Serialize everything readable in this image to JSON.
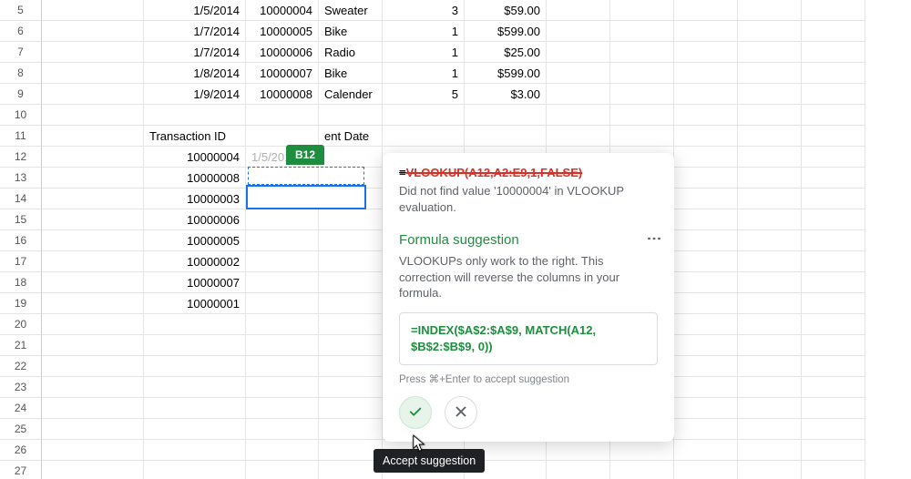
{
  "rows": [
    {
      "n": "5",
      "a": "",
      "b": "1/5/2014",
      "c": "10000004",
      "d": "Sweater",
      "e": "3",
      "f": "$59.00"
    },
    {
      "n": "6",
      "a": "",
      "b": "1/7/2014",
      "c": "10000005",
      "d": "Bike",
      "e": "1",
      "f": "$599.00"
    },
    {
      "n": "7",
      "a": "",
      "b": "1/7/2014",
      "c": "10000006",
      "d": "Radio",
      "e": "1",
      "f": "$25.00"
    },
    {
      "n": "8",
      "a": "",
      "b": "1/8/2014",
      "c": "10000007",
      "d": "Bike",
      "e": "1",
      "f": "$599.00"
    },
    {
      "n": "9",
      "a": "",
      "b": "1/9/2014",
      "c": "10000008",
      "d": "Calender",
      "e": "5",
      "f": "$3.00"
    },
    {
      "n": "10",
      "a": "",
      "b": "",
      "c": "",
      "d": "",
      "e": "",
      "f": ""
    },
    {
      "n": "11",
      "a": "",
      "b": "Transaction ID",
      "c": "",
      "d": "        ent Date",
      "e": "",
      "f": ""
    },
    {
      "n": "12",
      "a": "",
      "b": "10000004",
      "c": "1/5/2014",
      "d": "",
      "e": "",
      "f": ""
    },
    {
      "n": "13",
      "a": "",
      "b": "10000008",
      "c": "",
      "d": "",
      "e": "",
      "f": ""
    },
    {
      "n": "14",
      "a": "",
      "b": "10000003",
      "c": "",
      "d": "",
      "e": "",
      "f": ""
    },
    {
      "n": "15",
      "a": "",
      "b": "10000006",
      "c": "",
      "d": "",
      "e": "",
      "f": ""
    },
    {
      "n": "16",
      "a": "",
      "b": "10000005",
      "c": "",
      "d": "",
      "e": "",
      "f": ""
    },
    {
      "n": "17",
      "a": "",
      "b": "10000002",
      "c": "",
      "d": "",
      "e": "",
      "f": ""
    },
    {
      "n": "18",
      "a": "",
      "b": "10000007",
      "c": "",
      "d": "",
      "e": "",
      "f": ""
    },
    {
      "n": "19",
      "a": "",
      "b": "10000001",
      "c": "",
      "d": "",
      "e": "",
      "f": ""
    },
    {
      "n": "20",
      "a": "",
      "b": "",
      "c": "",
      "d": "",
      "e": "",
      "f": ""
    },
    {
      "n": "21",
      "a": "",
      "b": "",
      "c": "",
      "d": "",
      "e": "",
      "f": ""
    },
    {
      "n": "22",
      "a": "",
      "b": "",
      "c": "",
      "d": "",
      "e": "",
      "f": ""
    },
    {
      "n": "23",
      "a": "",
      "b": "",
      "c": "",
      "d": "",
      "e": "",
      "f": ""
    },
    {
      "n": "24",
      "a": "",
      "b": "",
      "c": "",
      "d": "",
      "e": "",
      "f": ""
    },
    {
      "n": "25",
      "a": "",
      "b": "",
      "c": "",
      "d": "",
      "e": "",
      "f": ""
    },
    {
      "n": "26",
      "a": "",
      "b": "",
      "c": "",
      "d": "",
      "e": "",
      "f": ""
    },
    {
      "n": "27",
      "a": "",
      "b": "",
      "c": "",
      "d": "",
      "e": "",
      "f": ""
    }
  ],
  "cellref": "B12",
  "popup": {
    "err_prefix": "=",
    "err_formula": "VLOOKUP(A12,A2:E9,1,FALSE)",
    "err_msg": "Did not find value '10000004' in VLOOKUP evaluation.",
    "title": "Formula suggestion",
    "desc": "VLOOKUPs only work to the right. This correction will reverse the columns in your formula.",
    "suggestion": "=INDEX($A$2:$A$9, MATCH(A12, $B$2:$B$9, 0))",
    "hint": "Press ⌘+Enter to accept suggestion"
  },
  "tooltip": "Accept suggestion"
}
